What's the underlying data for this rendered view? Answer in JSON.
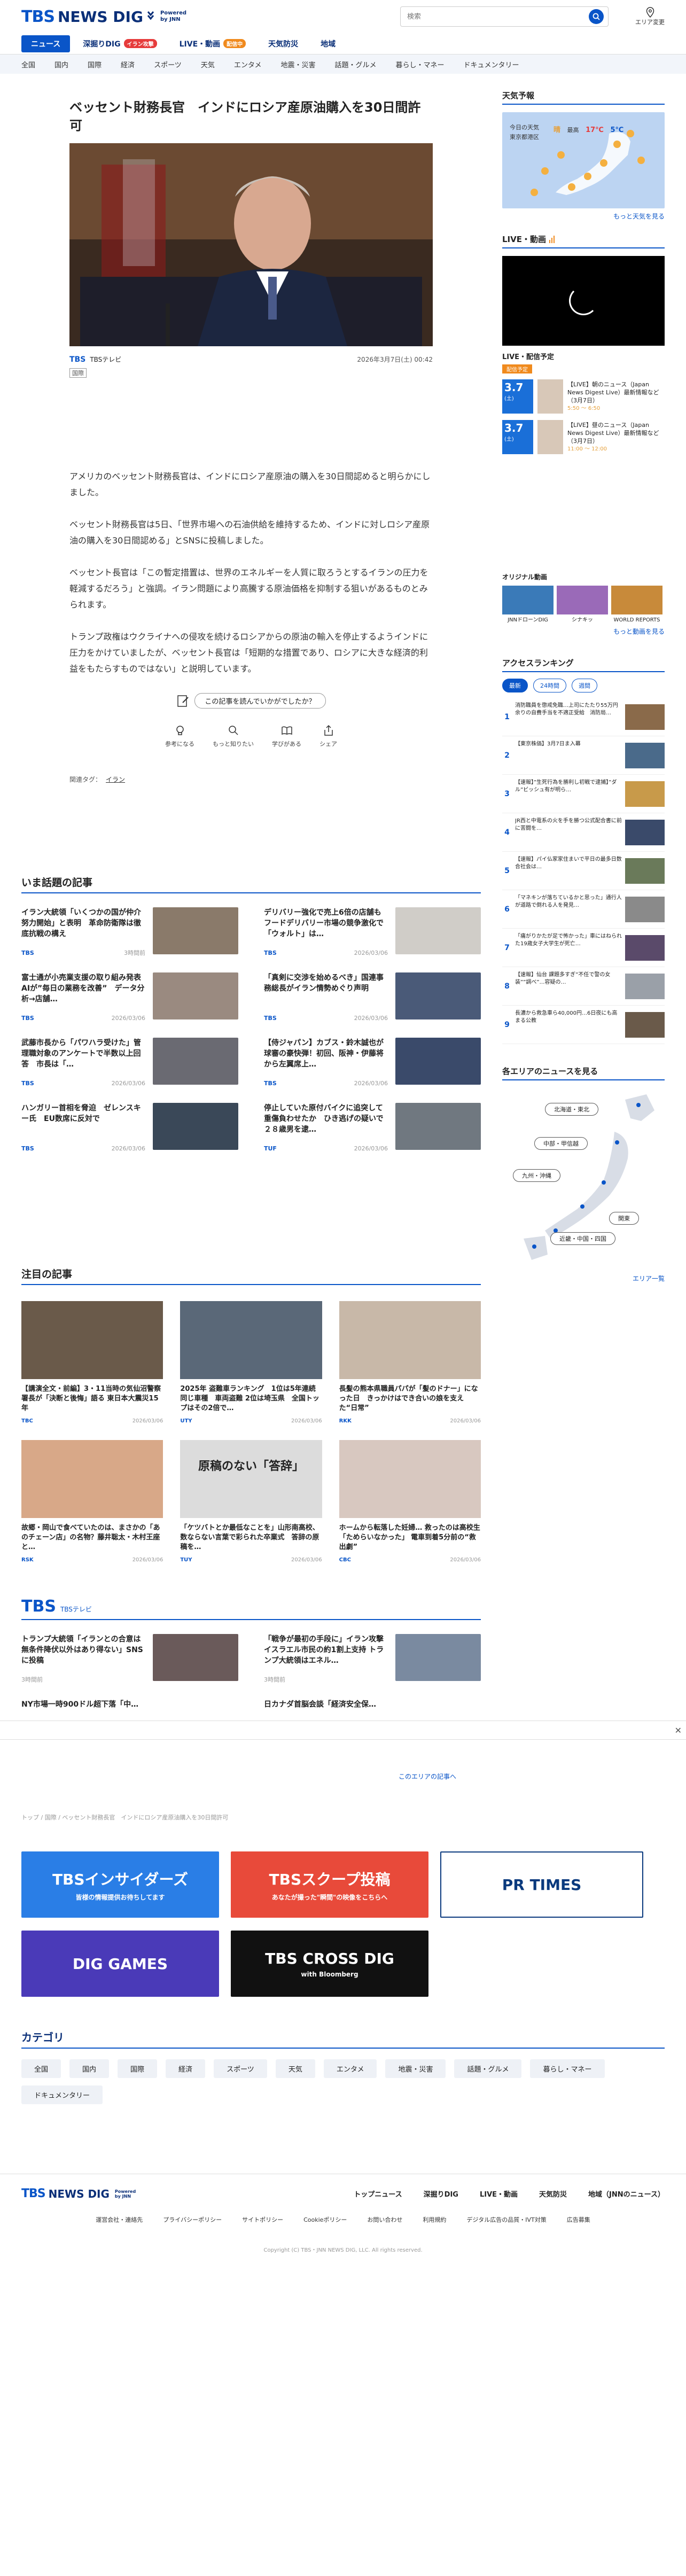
{
  "header": {
    "logo_tbs": "TBS",
    "logo_newsdig": "NEWS DIG",
    "logo_powered": "Powered",
    "logo_by": "by JNN",
    "search_placeholder": "検索",
    "area_label": "エリア変更"
  },
  "nav": {
    "items": [
      {
        "label": "ニュース",
        "active": true
      },
      {
        "label": "深掘りDIG",
        "badge": "イラン攻撃",
        "badge_color": "#e63b3b"
      },
      {
        "label": "LIVE・動画",
        "badge": "配信中",
        "badge_color": "#f08a1d"
      },
      {
        "label": "天気防災"
      },
      {
        "label": "地域"
      }
    ],
    "sub": [
      "全国",
      "国内",
      "国際",
      "経済",
      "スポーツ",
      "天気",
      "エンタメ",
      "地震・災害",
      "話題・グルメ",
      "暮らし・マネー",
      "ドキュメンタリー"
    ]
  },
  "article": {
    "title": "ベッセント財務長官　インドにロシア産原油購入を30日間許可",
    "source": "TBSテレビ",
    "source_logo": "TBS",
    "date": "2026年3月7日(土) 00:42",
    "caption_tag": "国際",
    "paragraphs": [
      "アメリカのベッセント財務長官は、インドにロシア産原油の購入を30日間認めると明らかにしました。",
      "ベッセント財務長官は5日、「世界市場への石油供給を維持するため、インドに対しロシア産原油の購入を30日間認める」とSNSに投稿しました。",
      "ベッセント長官は「この暫定措置は、世界のエネルギーを人質に取ろうとするイランの圧力を軽減するだろう」と強調。イラン問題により高騰する原油価格を抑制する狙いがあるものとみられます。",
      "トランプ政権はウクライナへの侵攻を続けるロシアからの原油の輸入を停止するようインドに圧力をかけていましたが、ベッセント長官は「短期的な措置であり、ロシアに大きな経済的利益をもたらすものではない」と説明しています。"
    ],
    "feedback_question": "この記事を読んでいかがでしたか？",
    "feedback_actions": [
      "参考になる",
      "もっと知りたい",
      "学びがある",
      "シェア"
    ],
    "tags_label": "関連タグ：",
    "tags": [
      "イラン"
    ]
  },
  "topics": {
    "heading": "いま話題の記事",
    "items": [
      {
        "title": "イラン大統領「いくつかの国が仲介努力開始」と表明　革命防衛隊は徹底抗戦の構え",
        "src": "TBS",
        "date": "3時間前",
        "color": "#8a7a6a"
      },
      {
        "title": "デリバリー強化で売上6倍の店舗も フードデリバリー市場の競争激化で「ウォルト」は…",
        "src": "TBS",
        "date": "2026/03/06",
        "color": "#d0cdc8"
      },
      {
        "title": "富士通が小売業支援の取り組み発表　AIが”毎日の業務を改善”　データ分析→店舗…",
        "src": "TBS",
        "date": "2026/03/06",
        "color": "#9a8a80"
      },
      {
        "title": "「真剣に交渉を始めるべき」国連事務総長がイラン情勢めぐり声明",
        "src": "TBS",
        "date": "2026/03/06",
        "color": "#4a5a78"
      },
      {
        "title": "武藤市長から「パワハラ受けた」管理職対象のアンケートで半数以上回答　市長は「…",
        "src": "TBS",
        "date": "2026/03/06",
        "color": "#6a6a72"
      },
      {
        "title": "【侍ジャパン】カブス・鈴木誠也が球審の豪快弾！初回、阪神・伊藤将から左翼席上…",
        "src": "TBS",
        "date": "2026/03/06",
        "color": "#3a4a6a"
      },
      {
        "title": "ハンガリー首相を脅迫　ゼレンスキー氏　EU数席に反対で",
        "src": "TBS",
        "date": "2026/03/06",
        "color": "#3a4858"
      },
      {
        "title": "停止していた原付バイクに追突して重傷負わせたか　ひき逃げの疑いで２８歳男を逮…",
        "src": "TUF",
        "date": "2026/03/06",
        "color": "#707880"
      }
    ]
  },
  "featured": {
    "heading": "注目の記事",
    "items": [
      {
        "title": "【講演全文・前編】3・11当時の気仙沼警察署長が「決断と後悔」語る 東日本大震災15年",
        "src": "TBC",
        "date": "2026/03/06",
        "color": "#6a5a4a"
      },
      {
        "title": "2025年 盗難車ランキング　1位は5年連続同じ車種　車両盗難 2位は埼玉県　全国トップはその2倍で…",
        "src": "UTY",
        "date": "2026/03/06",
        "color": "#5a6878"
      },
      {
        "title": "長髪の熊本県職員パパが「髪のドナー」になった日　きっかけはでき合いの娘を支えた“日常”",
        "src": "RKK",
        "date": "2026/03/06",
        "color": "#c8b8a8"
      },
      {
        "title": "故郷・岡山で食べていたのは、まさかの「あのチェーン店」の名物？藤井聡太・木村王座と…",
        "src": "RSK",
        "date": "2026/03/06",
        "color": "#d8a888"
      },
      {
        "title": "「ケツバトとか最低なことを」山形南高校、数ならない言葉で彩られた卒業式　答辞の原稿を…",
        "src": "TUY",
        "date": "2026/03/06",
        "color": "#dcdcdc",
        "overlay": "原稿のない「答辞」"
      },
      {
        "title": "ホームから転落した妊婦… 救ったのは高校生「ためらいなかった」 電車到着5分前の“救出劇”",
        "src": "CBC",
        "date": "2026/03/06",
        "color": "#d8c8c0"
      }
    ]
  },
  "tbs_block": {
    "title": "TBS",
    "sub": "TBSテレビ",
    "items": [
      {
        "title": "トランプ大統領「イランとの合意は無条件降伏以外はあり得ない」SNSに投稿",
        "date": "3時間前",
        "color": "#6a5a5a"
      },
      {
        "title": "「戦争が最初の手段に」イラン攻撃イスラエル市民の約1割上支持 トランプ大統領はエネル…",
        "date": "3時間前",
        "color": "#7a8aa0"
      },
      {
        "title": "NY市場一時900ドル超下落「中…",
        "date": "",
        "color": "#888"
      },
      {
        "title": "日カナダ首脳会談「経済安全保…",
        "date": "",
        "color": "#888"
      }
    ]
  },
  "sidebar": {
    "weather_heading": "天気予報",
    "weather_loc": "今日の天気\n東京都港区",
    "weather_sky": "晴",
    "weather_fc": "最高",
    "weather_hi": "17℃",
    "weather_lo": "5℃",
    "weather_more": "もっと天気を見る",
    "live_heading": "LIVE・動画",
    "sched_heading": "LIVE・配信予定",
    "sched_tag": "配信予定",
    "sched": [
      {
        "date": "3.7",
        "day": "(土)",
        "title": "【LIVE】朝のニュース（Japan News Digest Live）最新情報など（3月7日）",
        "time": "5:50 〜 6:50"
      },
      {
        "date": "3.7",
        "day": "(土)",
        "title": "【LIVE】昼のニュース（Japan News Digest Live）最新情報など（3月7日）",
        "time": "11:00 〜 12:00"
      }
    ],
    "orig_heading": "オリジナル動画",
    "orig": [
      {
        "label": "JNNドローンDIG",
        "color": "#3a7ab8"
      },
      {
        "label": "シナキッ",
        "color": "#9a6ab8"
      },
      {
        "label": "WORLD REPORTS",
        "color": "#c88a3a"
      }
    ],
    "orig_more": "もっと動画を見る",
    "rank_heading": "アクセスランキング",
    "rank_tabs": [
      "最新",
      "24時間",
      "週間"
    ],
    "rank": [
      "消防職員を懲戒免職…上司にたたり55万円余りの自費手当を不適正受給　消防局…",
      "【東京株価】3月7日ま入幕",
      "【速報】”生死行為を勝利し初戦で逮捕】”ダル”ビッシュ有が明ら…",
      "JR西と中電系の火を手を勝つ公式配合書に前に苦闘を…",
      "【速報】パイ仏家家住まいで平日の最多日数合社会は…",
      "「マネキンが落ちているかと思った」通行人が道路で倒れる人を発見…",
      "「痛がりかたが足で怖かった」車にはねられた19歳女子大学生が死亡…",
      "【速報】仙台 課題多すぎ”不任で警の女装””調べ”…容疑の…",
      "長濃から救急車ら40,000円…6日夜にも高まる公教"
    ],
    "area_heading": "各エリアのニュースを見る",
    "area_buttons": [
      "北海道・東北",
      "中部・甲信越",
      "九州・沖縄",
      "関東",
      "近畿・中国・四国"
    ],
    "area_more": "エリア一覧"
  },
  "bottom": {
    "area_news_more": "このエリアの記事へ",
    "breadcrumb": "トップ / 国際 / ベッセント財務長官　インドにロシア産原油購入を30日間許可",
    "banners": [
      {
        "text": "TBSインサイダーズ",
        "sub": "皆様の情報提供お待ちしてます",
        "bg": "#2a7ee6",
        "fg": "#fff"
      },
      {
        "text": "TBSスクープ投稿",
        "sub": "あなたが撮った\"瞬間\"の映像をこちらへ",
        "bg": "#e84a3a",
        "fg": "#fff"
      },
      {
        "text": "PR TIMES",
        "bg": "#fff",
        "fg": "#0a3a7e"
      },
      {
        "text": "DIG GAMES",
        "bg": "#4a3ab8",
        "fg": "#fff"
      },
      {
        "text": "TBS CROSS DIG",
        "sub": "with Bloomberg",
        "bg": "#111",
        "fg": "#fff"
      }
    ],
    "cat_heading": "カテゴリ",
    "cats": [
      "全国",
      "国内",
      "国際",
      "経済",
      "スポーツ",
      "天気",
      "エンタメ",
      "地震・災害",
      "話題・グルメ",
      "暮らし・マネー",
      "ドキュメンタリー"
    ]
  },
  "footer": {
    "links1": [
      "トップニュース",
      "深掘りDIG",
      "LIVE・動画",
      "天気防災",
      "地域（JNNのニュース）"
    ],
    "links2": [
      "運営会社・連絡先",
      "プライバシーポリシー",
      "サイトポリシー",
      "Cookieポリシー",
      "お問い合わせ",
      "利用規約",
      "デジタル広告の品質・IVT対策",
      "広告募集"
    ],
    "copyright": "Copyright (C) TBS・JNN NEWS DIG, LLC. All rights reserved."
  },
  "colors": {
    "brand": "#0a55c8",
    "brand_dark": "#0a2f78"
  }
}
